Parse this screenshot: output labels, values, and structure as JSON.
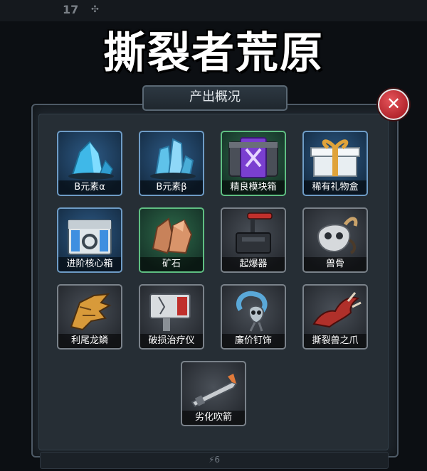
{
  "background": {
    "energy_count": "17",
    "energy_icon": "✣",
    "bottom_hint": "⚡6"
  },
  "title": "撕裂者荒原",
  "panel": {
    "header": "产出概况",
    "close_icon": "✕"
  },
  "items": [
    {
      "label": "B元素α",
      "rarity": "blue",
      "icon": "blue-crystal-icon"
    },
    {
      "label": "B元素β",
      "rarity": "blue",
      "icon": "blue-crystal-cluster-icon"
    },
    {
      "label": "精良模块箱",
      "rarity": "green",
      "icon": "purple-module-crate-icon"
    },
    {
      "label": "稀有礼物盒",
      "rarity": "blue",
      "icon": "gift-box-icon"
    },
    {
      "label": "进阶核心箱",
      "rarity": "blue",
      "icon": "tech-core-box-icon"
    },
    {
      "label": "矿石",
      "rarity": "green",
      "icon": "copper-ore-icon"
    },
    {
      "label": "起爆器",
      "rarity": "gray",
      "icon": "detonator-icon"
    },
    {
      "label": "兽骨",
      "rarity": "gray",
      "icon": "beast-skull-icon"
    },
    {
      "label": "利尾龙鳞",
      "rarity": "gray",
      "icon": "dragon-scale-icon"
    },
    {
      "label": "破损治疗仪",
      "rarity": "gray",
      "icon": "broken-healer-icon"
    },
    {
      "label": "廉价钉饰",
      "rarity": "gray",
      "icon": "skull-claw-ornament-icon"
    },
    {
      "label": "撕裂兽之爪",
      "rarity": "gray",
      "icon": "ripper-claw-icon"
    },
    {
      "label": "劣化吹箭",
      "rarity": "gray",
      "icon": "blowdart-icon"
    }
  ],
  "colors": {
    "blue_border": "#6e9cc6",
    "green_border": "#5fbf82",
    "gray_border": "#7a828a",
    "close_red": "#c8323a"
  }
}
